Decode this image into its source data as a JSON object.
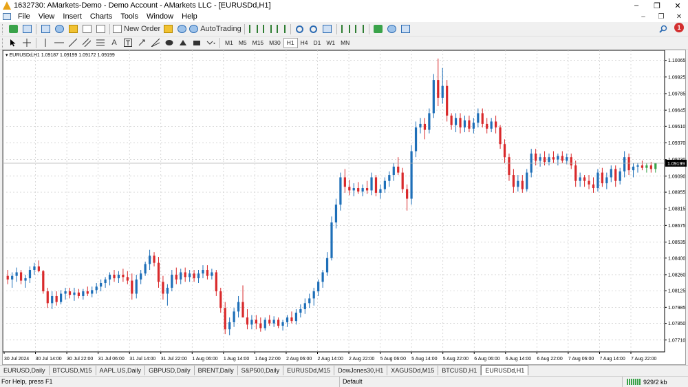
{
  "window": {
    "title": "1632730: AMarkets-Demo - Demo Account - AMarkets LLC - [EURUSDd,H1]",
    "controls": [
      "–",
      "❐",
      "✕"
    ]
  },
  "menu": {
    "items": [
      "File",
      "View",
      "Insert",
      "Charts",
      "Tools",
      "Window",
      "Help"
    ],
    "mdi_controls": [
      "–",
      "❐",
      "✕"
    ]
  },
  "toolbar": {
    "new_order_label": "New Order",
    "autotrading_label": "AutoTrading",
    "alert_count": "1",
    "timeframes": [
      "M1",
      "M5",
      "M15",
      "M30",
      "H1",
      "H4",
      "D1",
      "W1",
      "MN"
    ],
    "active_timeframe": "H1",
    "text_tool_label": "A"
  },
  "chart_header": "EURUSDd,H1  1.09187 1.09199 1.09172 1.09199",
  "chart_data": {
    "type": "candlestick",
    "symbol": "EURUSDd",
    "timeframe": "H1",
    "current_price": "1.09199",
    "ylim": [
      1.0761,
      1.1015
    ],
    "y_ticks": [
      "1.10065",
      "1.09925",
      "1.09785",
      "1.09645",
      "1.09510",
      "1.09370",
      "1.09230",
      "1.09090",
      "1.08955",
      "1.08815",
      "1.08675",
      "1.08535",
      "1.08400",
      "1.08260",
      "1.08125",
      "1.07985",
      "1.07850",
      "1.07710"
    ],
    "x_ticks": [
      "30 Jul 2024",
      "30 Jul 14:00",
      "30 Jul 22:00",
      "31 Jul 06:00",
      "31 Jul 14:00",
      "31 Jul 22:00",
      "1 Aug 06:00",
      "1 Aug 14:00",
      "1 Aug 22:00",
      "2 Aug 06:00",
      "2 Aug 14:00",
      "2 Aug 22:00",
      "5 Aug 06:00",
      "5 Aug 14:00",
      "5 Aug 22:00",
      "6 Aug 06:00",
      "6 Aug 14:00",
      "6 Aug 22:00",
      "7 Aug 06:00",
      "7 Aug 14:00",
      "7 Aug 22:00"
    ],
    "grid": true,
    "candles": [
      [
        1.0825,
        1.083,
        1.0818,
        1.0822
      ],
      [
        1.0822,
        1.0828,
        1.0815,
        1.0825
      ],
      [
        1.0825,
        1.0832,
        1.082,
        1.0828
      ],
      [
        1.0828,
        1.083,
        1.0818,
        1.0821
      ],
      [
        1.0821,
        1.0826,
        1.0815,
        1.0823
      ],
      [
        1.0823,
        1.0833,
        1.0819,
        1.083
      ],
      [
        1.083,
        1.0836,
        1.0826,
        1.0833
      ],
      [
        1.0833,
        1.0838,
        1.0828,
        1.0829
      ],
      [
        1.0829,
        1.083,
        1.081,
        1.0812
      ],
      [
        1.0812,
        1.0815,
        1.0798,
        1.0802
      ],
      [
        1.0802,
        1.0812,
        1.0797,
        1.0808
      ],
      [
        1.0808,
        1.0812,
        1.08,
        1.0803
      ],
      [
        1.0803,
        1.0813,
        1.0801,
        1.081
      ],
      [
        1.081,
        1.0815,
        1.0805,
        1.0812
      ],
      [
        1.0812,
        1.0815,
        1.0806,
        1.0809
      ],
      [
        1.0809,
        1.0815,
        1.0804,
        1.0811
      ],
      [
        1.0811,
        1.0814,
        1.0806,
        1.0808
      ],
      [
        1.0808,
        1.0814,
        1.0805,
        1.0812
      ],
      [
        1.0812,
        1.0816,
        1.0808,
        1.081
      ],
      [
        1.081,
        1.0816,
        1.0807,
        1.0813
      ],
      [
        1.0813,
        1.0819,
        1.081,
        1.0816
      ],
      [
        1.0816,
        1.0822,
        1.0812,
        1.0819
      ],
      [
        1.0819,
        1.0824,
        1.0815,
        1.0822
      ],
      [
        1.0822,
        1.0828,
        1.0817,
        1.0826
      ],
      [
        1.0826,
        1.083,
        1.082,
        1.0823
      ],
      [
        1.0823,
        1.0829,
        1.0819,
        1.0826
      ],
      [
        1.0826,
        1.0831,
        1.082,
        1.0824
      ],
      [
        1.0824,
        1.0829,
        1.0818,
        1.0821
      ],
      [
        1.0821,
        1.0827,
        1.0805,
        1.081
      ],
      [
        1.081,
        1.0826,
        1.0806,
        1.0822
      ],
      [
        1.0822,
        1.083,
        1.0818,
        1.0827
      ],
      [
        1.0827,
        1.0837,
        1.0825,
        1.0835
      ],
      [
        1.0835,
        1.0847,
        1.083,
        1.0842
      ],
      [
        1.0842,
        1.0845,
        1.0833,
        1.0836
      ],
      [
        1.0836,
        1.0841,
        1.0815,
        1.082
      ],
      [
        1.082,
        1.0825,
        1.0805,
        1.081
      ],
      [
        1.081,
        1.0818,
        1.08,
        1.0815
      ],
      [
        1.0815,
        1.083,
        1.0812,
        1.0826
      ],
      [
        1.0826,
        1.0832,
        1.0818,
        1.0822
      ],
      [
        1.0822,
        1.0831,
        1.0818,
        1.0828
      ],
      [
        1.0828,
        1.0832,
        1.082,
        1.0824
      ],
      [
        1.0824,
        1.083,
        1.082,
        1.0827
      ],
      [
        1.0827,
        1.083,
        1.082,
        1.0823
      ],
      [
        1.0823,
        1.083,
        1.0819,
        1.0827
      ],
      [
        1.0827,
        1.0834,
        1.0823,
        1.083
      ],
      [
        1.083,
        1.0834,
        1.0822,
        1.0825
      ],
      [
        1.0825,
        1.0831,
        1.0822,
        1.0828
      ],
      [
        1.0828,
        1.083,
        1.0808,
        1.0812
      ],
      [
        1.0812,
        1.0815,
        1.0794,
        1.0798
      ],
      [
        1.0798,
        1.0803,
        1.0776,
        1.078
      ],
      [
        1.078,
        1.079,
        1.0775,
        1.0786
      ],
      [
        1.0786,
        1.0798,
        1.0782,
        1.0795
      ],
      [
        1.0795,
        1.0808,
        1.079,
        1.0803
      ],
      [
        1.0803,
        1.0817,
        1.0797,
        1.079
      ],
      [
        1.079,
        1.0797,
        1.078,
        1.0784
      ],
      [
        1.0784,
        1.0792,
        1.078,
        1.0788
      ],
      [
        1.0788,
        1.0792,
        1.078,
        1.0785
      ],
      [
        1.0785,
        1.079,
        1.0778,
        1.0781
      ],
      [
        1.0781,
        1.079,
        1.0779,
        1.0788
      ],
      [
        1.0788,
        1.0792,
        1.0783,
        1.0785
      ],
      [
        1.0785,
        1.0791,
        1.0782,
        1.0788
      ],
      [
        1.0788,
        1.079,
        1.0781,
        1.0783
      ],
      [
        1.0783,
        1.0788,
        1.0779,
        1.0786
      ],
      [
        1.0786,
        1.0792,
        1.0782,
        1.079
      ],
      [
        1.079,
        1.0795,
        1.0785,
        1.0787
      ],
      [
        1.0787,
        1.0797,
        1.0784,
        1.0794
      ],
      [
        1.0794,
        1.0801,
        1.079,
        1.0797
      ],
      [
        1.0797,
        1.0806,
        1.0793,
        1.0802
      ],
      [
        1.0802,
        1.081,
        1.0798,
        1.0806
      ],
      [
        1.0806,
        1.0815,
        1.08,
        1.0812
      ],
      [
        1.0812,
        1.0822,
        1.0808,
        1.082
      ],
      [
        1.082,
        1.083,
        1.0815,
        1.0828
      ],
      [
        1.0828,
        1.0845,
        1.0825,
        1.084
      ],
      [
        1.084,
        1.0875,
        1.0838,
        1.087
      ],
      [
        1.087,
        1.089,
        1.0865,
        1.0885
      ],
      [
        1.0885,
        1.0912,
        1.088,
        1.0908
      ],
      [
        1.0908,
        1.0915,
        1.0895,
        1.09
      ],
      [
        1.09,
        1.0906,
        1.0893,
        1.0897
      ],
      [
        1.0897,
        1.0903,
        1.0892,
        1.0899
      ],
      [
        1.0899,
        1.0904,
        1.0894,
        1.0896
      ],
      [
        1.0896,
        1.0902,
        1.0892,
        1.0899
      ],
      [
        1.0899,
        1.0905,
        1.0894,
        1.0897
      ],
      [
        1.0897,
        1.0912,
        1.0893,
        1.0908
      ],
      [
        1.0908,
        1.091,
        1.0892,
        1.0895
      ],
      [
        1.0895,
        1.0902,
        1.089,
        1.0898
      ],
      [
        1.0898,
        1.0908,
        1.0895,
        1.0905
      ],
      [
        1.0905,
        1.0913,
        1.09,
        1.091
      ],
      [
        1.091,
        1.092,
        1.0905,
        1.0917
      ],
      [
        1.0917,
        1.0925,
        1.091,
        1.0912
      ],
      [
        1.0912,
        1.0916,
        1.0895,
        1.0898
      ],
      [
        1.0898,
        1.0902,
        1.088,
        1.089
      ],
      [
        1.089,
        1.0935,
        1.0885,
        1.093
      ],
      [
        1.093,
        1.0955,
        1.0925,
        1.095
      ],
      [
        1.095,
        1.0958,
        1.0945,
        1.0953
      ],
      [
        1.0953,
        1.0958,
        1.094,
        1.0948
      ],
      [
        1.0948,
        1.0966,
        1.0945,
        1.0962
      ],
      [
        1.0962,
        1.0995,
        1.0958,
        1.099
      ],
      [
        1.099,
        1.1008,
        1.0968,
        1.0975
      ],
      [
        1.0975,
        1.1,
        1.097,
        1.0985
      ],
      [
        1.0985,
        1.099,
        1.0955,
        1.096
      ],
      [
        1.096,
        1.0962,
        1.0948,
        1.0952
      ],
      [
        1.0952,
        1.0962,
        1.0946,
        1.0958
      ],
      [
        1.0958,
        1.0962,
        1.0945,
        1.095
      ],
      [
        1.095,
        1.096,
        1.0946,
        1.0956
      ],
      [
        1.0956,
        1.096,
        1.0946,
        1.0949
      ],
      [
        1.0949,
        1.0958,
        1.0945,
        1.0954
      ],
      [
        1.0954,
        1.0966,
        1.095,
        1.0962
      ],
      [
        1.0962,
        1.0966,
        1.095,
        1.0953
      ],
      [
        1.0953,
        1.0958,
        1.0945,
        1.0949
      ],
      [
        1.0949,
        1.0958,
        1.0946,
        1.0955
      ],
      [
        1.0955,
        1.096,
        1.0945,
        1.095
      ],
      [
        1.095,
        1.0952,
        1.0932,
        1.0936
      ],
      [
        1.0936,
        1.094,
        1.092,
        1.0925
      ],
      [
        1.0925,
        1.0928,
        1.0905,
        1.091
      ],
      [
        1.091,
        1.0915,
        1.0895,
        1.09
      ],
      [
        1.09,
        1.091,
        1.0896,
        1.0905
      ],
      [
        1.0905,
        1.091,
        1.0895,
        1.0898
      ],
      [
        1.0898,
        1.0915,
        1.0896,
        1.0912
      ],
      [
        1.0912,
        1.0932,
        1.0908,
        1.0928
      ],
      [
        1.0928,
        1.0932,
        1.0918,
        1.0922
      ],
      [
        1.0922,
        1.0928,
        1.0917,
        1.0925
      ],
      [
        1.0925,
        1.093,
        1.0918,
        1.0921
      ],
      [
        1.0921,
        1.0928,
        1.0918,
        1.0925
      ],
      [
        1.0925,
        1.093,
        1.092,
        1.0923
      ],
      [
        1.0923,
        1.0928,
        1.0918,
        1.0926
      ],
      [
        1.0926,
        1.093,
        1.092,
        1.0922
      ],
      [
        1.0922,
        1.0928,
        1.0919,
        1.0925
      ],
      [
        1.0925,
        1.0928,
        1.0915,
        1.0918
      ],
      [
        1.0918,
        1.0922,
        1.09,
        1.0905
      ],
      [
        1.0905,
        1.0912,
        1.09,
        1.0908
      ],
      [
        1.0908,
        1.091,
        1.09,
        1.0905
      ],
      [
        1.0905,
        1.091,
        1.0898,
        1.0902
      ],
      [
        1.0902,
        1.0908,
        1.0895,
        1.0899
      ],
      [
        1.0899,
        1.0915,
        1.0896,
        1.0912
      ],
      [
        1.0912,
        1.0916,
        1.09,
        1.0903
      ],
      [
        1.0903,
        1.0912,
        1.0898,
        1.0908
      ],
      [
        1.0908,
        1.0918,
        1.0904,
        1.0915
      ],
      [
        1.0915,
        1.0918,
        1.09,
        1.0905
      ],
      [
        1.0905,
        1.0916,
        1.0902,
        1.0913
      ],
      [
        1.0913,
        1.093,
        1.0908,
        1.0925
      ],
      [
        1.0925,
        1.0928,
        1.091,
        1.0914
      ],
      [
        1.0914,
        1.092,
        1.0908,
        1.0917
      ],
      [
        1.0917,
        1.092,
        1.0912,
        1.0918
      ],
      [
        1.0918,
        1.0922,
        1.0914,
        1.0916
      ],
      [
        1.0916,
        1.092,
        1.0912,
        1.0918
      ],
      [
        1.0918,
        1.0921,
        1.0912,
        1.0915
      ],
      [
        1.0915,
        1.092,
        1.0912,
        1.092
      ]
    ]
  },
  "tabs": [
    "EURUSD,Daily",
    "BTCUSD,M15",
    "AAPL.US,Daily",
    "GBPUSD,Daily",
    "BRENT,Daily",
    "S&P500,Daily",
    "EURUSDd,M15",
    "DowJones30,H1",
    "XAGUSDd,M15",
    "BTCUSD,H1",
    "EURUSDd,H1"
  ],
  "active_tab": "EURUSDd,H1",
  "status": {
    "help": "For Help, press F1",
    "profile": "Default",
    "traffic": "929/2 kb"
  },
  "colors": {
    "bull": "#1e6fb8",
    "bear": "#d9292b",
    "neutral": "#3aa34a",
    "grid": "#c8c8c8"
  }
}
